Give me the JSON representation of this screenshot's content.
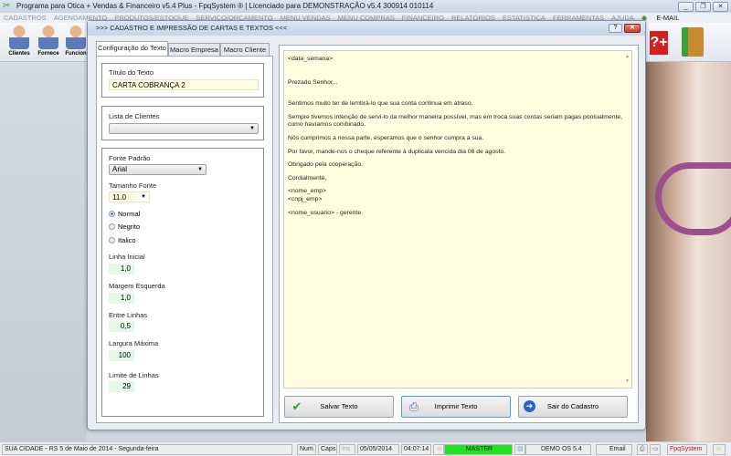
{
  "app": {
    "title": "Programa para Otica + Vendas & Financeiro v5.4 Plus - FpqSystem ® | Licenciado para  DEMONSTRAÇÃO v5.4 300914 010114"
  },
  "menu": [
    "CADASTROS",
    "AGENDAMENTO",
    "PRODUTOS/ESTOQUE",
    "SERVIÇO/ORÇAMENTO",
    "MENU VENDAS",
    "MENU COMPRAS",
    "FINANCEIRO",
    "RELATÓRIOS",
    "ESTATISTICA",
    "FERRAMENTAS",
    "AJUDA",
    "E-MAIL"
  ],
  "toolbar": {
    "clientes": "Clientes",
    "fornece": "Fornece",
    "funcion": "Funcion"
  },
  "dialog": {
    "title": ">>> CADASTRO E IMPRESSÃO DE CARTAS E TEXTOS <<<",
    "help": "?",
    "close": "✕",
    "tabs": [
      "Configuração do Texto",
      "Macro Empresa",
      "Macro Cliente"
    ],
    "titulo_label": "Título do Texto",
    "titulo_value": "CARTA COBRANÇA 2",
    "clientes_label": "Lista de Clientes",
    "clientes_value": "",
    "fonte_label": "Fonte Padrão",
    "fonte_value": "Arial",
    "tamanho_label": "Tamanho Fonte",
    "tamanho_value": "11.0",
    "estilos": [
      "Normal",
      "Negrito",
      "Italico"
    ],
    "estilo_selected": "Normal",
    "linha_inicial_label": "Linha Inicial",
    "linha_inicial": "1,0",
    "margem_label": "Margem Esquerda",
    "margem": "1,0",
    "entre_label": "Entre Linhas",
    "entre": "0,5",
    "largura_label": "Largura Máxima",
    "largura": "100",
    "limite_label": "Limite de Linhas",
    "limite": "29",
    "letter": [
      "<data_semana>",
      "",
      "",
      "Prezado Senhor...",
      "",
      "Sentimos muito ter de lembrá-lo que sua conta continua em atraso.",
      "Sempre tivemos intenção de servi-lo da melhor maneira possível, mas em troca suas contas seriam pagas pontualmente,\ncomo havíamos combinado.",
      "Nós cumprimos a nossa parte, esperamos que o senhor cumpra a sua.",
      "Por favor, mande-nos o cheque referente à duplicata vencida dia 06 de agosto.",
      "Obrigado pela cooperação.",
      "Cordialmente,",
      "<nome_emp>\n<cnpj_emp>",
      "<nome_usuario> - gerente."
    ],
    "salvar": "Salvar Texto",
    "imprimir": "Imprimir Texto",
    "sair": "Sair do Cadastro"
  },
  "status": {
    "cidade": "SUA CIDADE - RS  5 de Maio de 2014 - Segunda-feira",
    "num": "Num",
    "caps": "Caps",
    "ins": "Ins",
    "data": "05/05/2014",
    "hora": "04:07:14",
    "user": "MASTER",
    "versao": "DEMO OS 5.4",
    "email": "Email",
    "brand": "FpqSystem"
  },
  "colors": {
    "master": "#22e022",
    "letter_bg": "#ffffdf"
  }
}
